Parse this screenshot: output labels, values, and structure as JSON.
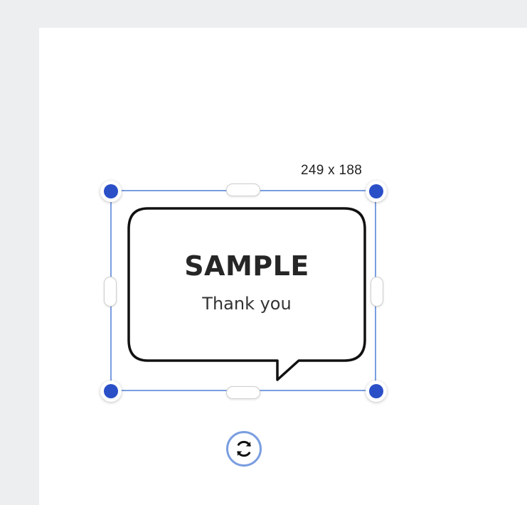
{
  "selection": {
    "size_label": "249 x 188"
  },
  "element": {
    "title": "SAMPLE",
    "subtitle": "Thank you"
  },
  "colors": {
    "selection_border": "#7a9ee0",
    "handle_fill": "#2a4fc7",
    "canvas_bg": "#ffffff",
    "workspace_bg": "#eceef0"
  },
  "icons": {
    "rotate": "rotate-arrows-icon"
  }
}
